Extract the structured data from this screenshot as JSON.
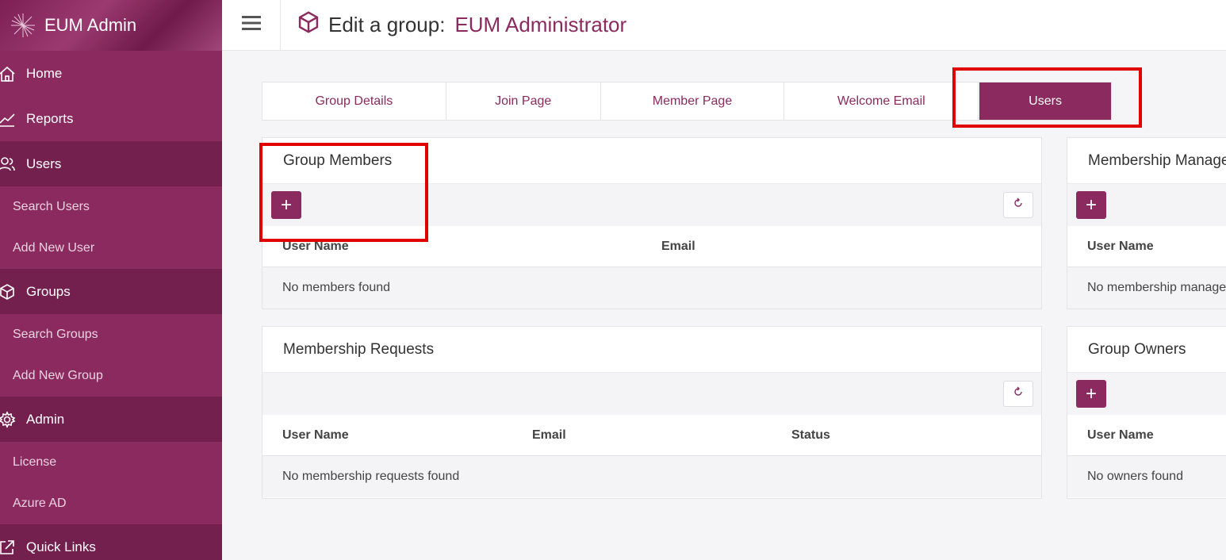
{
  "app": {
    "name": "EUM Admin"
  },
  "sidebar": {
    "home": "Home",
    "reports": "Reports",
    "users": "Users",
    "search_users": "Search Users",
    "add_new_user": "Add New User",
    "groups": "Groups",
    "search_groups": "Search Groups",
    "add_new_group": "Add New Group",
    "admin": "Admin",
    "license": "License",
    "azure_ad": "Azure AD",
    "quick_links": "Quick Links"
  },
  "header": {
    "title_prefix": "Edit a group:",
    "group_name": "EUM Administrator"
  },
  "tabs": [
    "Group Details",
    "Join Page",
    "Member Page",
    "Welcome Email",
    "Users"
  ],
  "active_tab": "Users",
  "group_members": {
    "title": "Group Members",
    "add_label": "+",
    "col_user_name": "User Name",
    "col_email": "Email",
    "empty": "No members found"
  },
  "membership_managers": {
    "title": "Membership Managers",
    "add_label": "+",
    "col_user_name": "User Name",
    "empty": "No membership managers found"
  },
  "membership_requests": {
    "title": "Membership Requests",
    "col_user_name": "User Name",
    "col_email": "Email",
    "col_status": "Status",
    "empty": "No membership requests found"
  },
  "group_owners": {
    "title": "Group Owners",
    "add_label": "+",
    "col_user_name": "User Name",
    "empty": "No owners found"
  },
  "colors": {
    "accent": "#8a2a5e",
    "sidebar": "#8a2a5e",
    "highlight": "#e00000"
  }
}
